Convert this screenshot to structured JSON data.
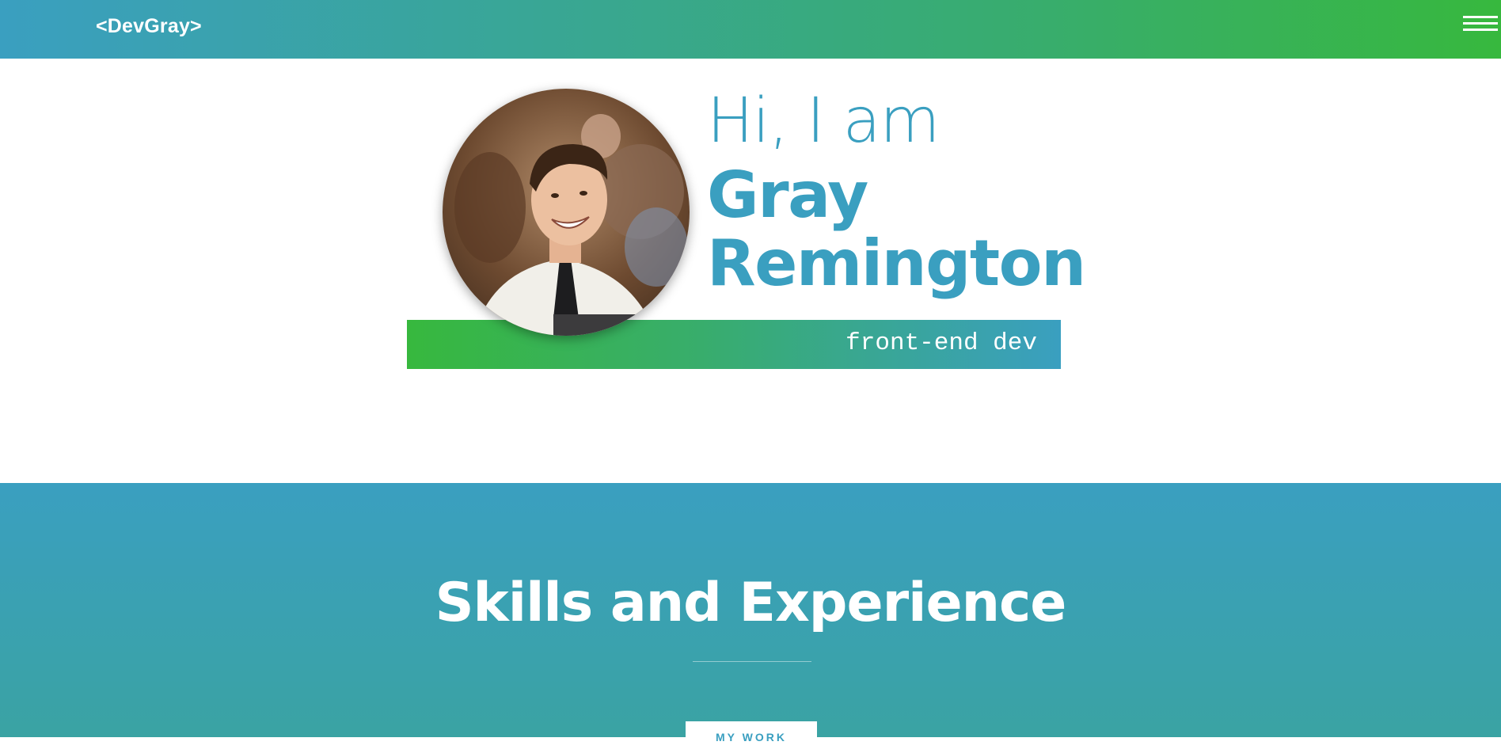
{
  "header": {
    "logo": "<DevGray>",
    "menu_icon": "hamburger-icon"
  },
  "hero": {
    "greeting": "Hi, I am",
    "first_name": "Gray",
    "last_name": "Remington",
    "tagline": "front-end dev",
    "avatar_alt": "profile-photo"
  },
  "skills": {
    "title": "Skills and Experience",
    "button_label": "MY WORK"
  },
  "colors": {
    "primary_blue": "#3a9fc0",
    "primary_green": "#37b83e",
    "background": "#ffffff",
    "text_light": "#ffffff"
  }
}
